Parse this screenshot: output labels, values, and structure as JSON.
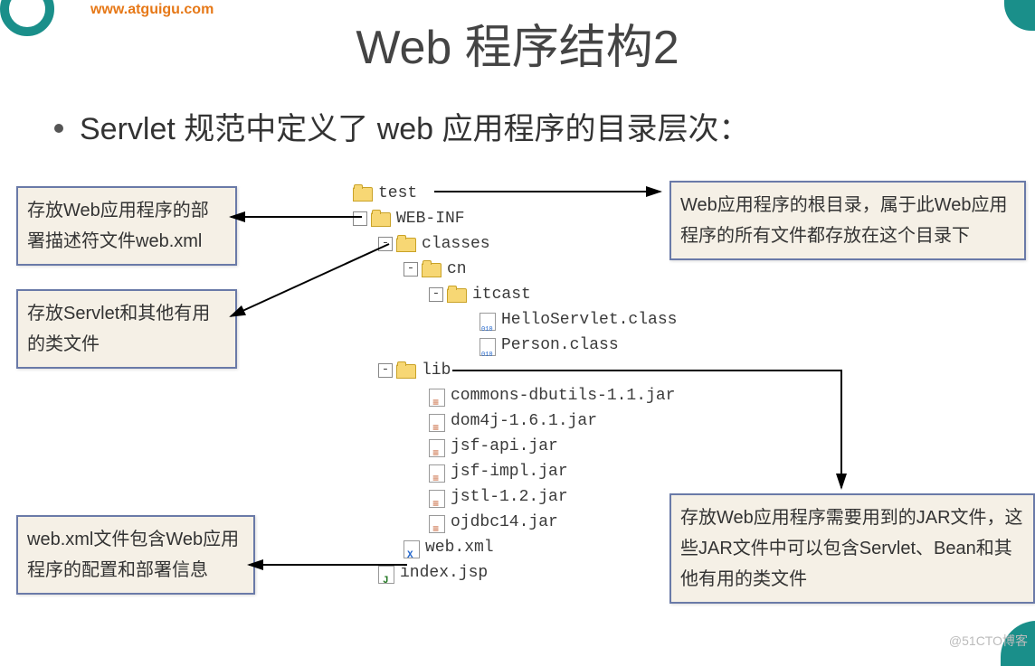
{
  "header": {
    "url": "www.atguigu.com",
    "title": "Web 程序结构2",
    "bullet": "Servlet 规范中定义了 web 应用程序的目录层次："
  },
  "tree": {
    "root": "test",
    "webinf": "WEB-INF",
    "classes": "classes",
    "pkg1": "cn",
    "pkg2": "itcast",
    "class1": "HelloServlet.class",
    "class2": "Person.class",
    "lib": "lib",
    "jar1": "commons-dbutils-1.1.jar",
    "jar2": "dom4j-1.6.1.jar",
    "jar3": "jsf-api.jar",
    "jar4": "jsf-impl.jar",
    "jar5": "jstl-1.2.jar",
    "jar6": "ojdbc14.jar",
    "webxml": "web.xml",
    "indexjsp": "index.jsp"
  },
  "callouts": {
    "c1": "存放Web应用程序的部署描述符文件web.xml",
    "c2": "存放Servlet和其他有用的类文件",
    "c3": "web.xml文件包含Web应用程序的配置和部署信息",
    "c4": "Web应用程序的根目录，属于此Web应用程序的所有文件都存放在这个目录下",
    "c5": "存放Web应用程序需要用到的JAR文件，这些JAR文件中可以包含Servlet、Bean和其他有用的类文件"
  },
  "watermark": "@51CTO博客"
}
